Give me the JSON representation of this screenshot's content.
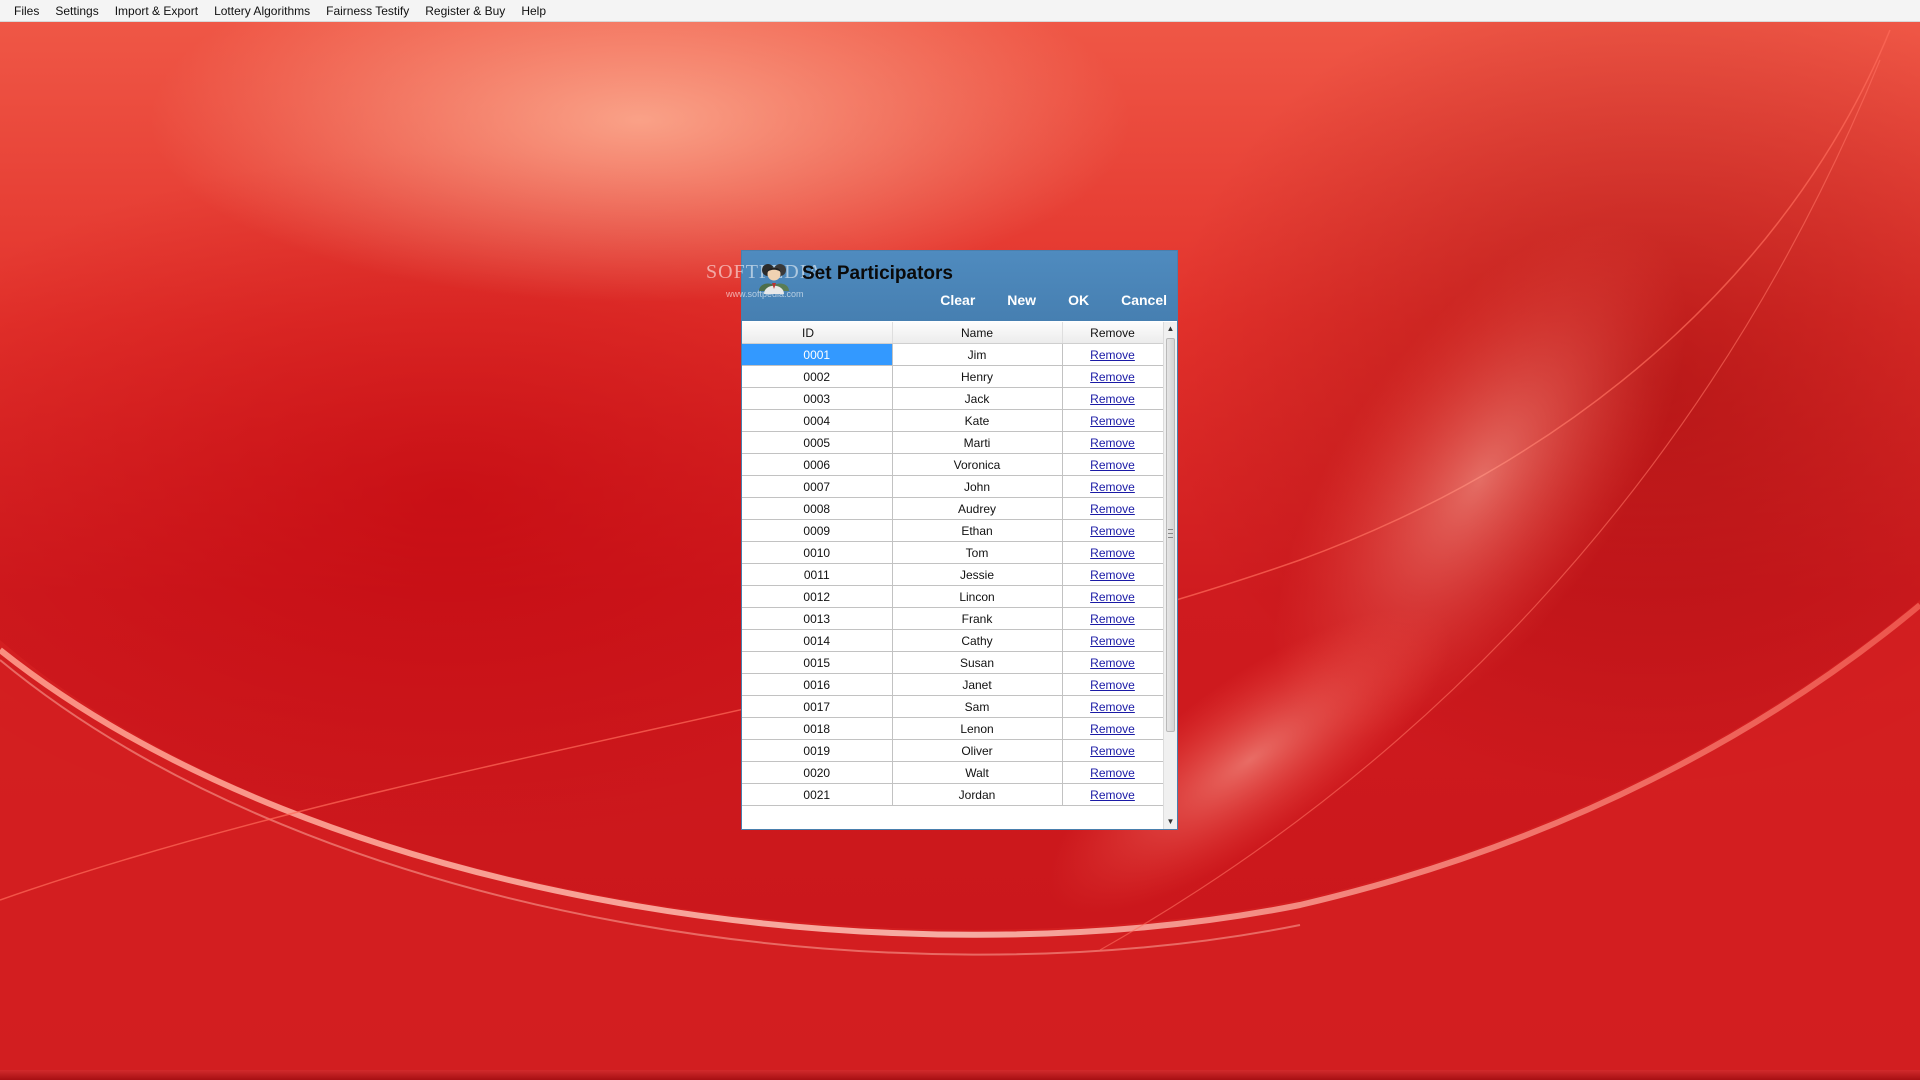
{
  "menubar": {
    "items": [
      {
        "label": "Files"
      },
      {
        "label": "Settings"
      },
      {
        "label": "Import & Export"
      },
      {
        "label": "Lottery Algorithms"
      },
      {
        "label": "Fairness Testify"
      },
      {
        "label": "Register & Buy"
      },
      {
        "label": "Help"
      }
    ]
  },
  "dialog": {
    "title": "Set Participators",
    "watermark": "SOFTPEDIA",
    "watermark_url": "www.softpedia.com",
    "icon": "participants-icon",
    "buttons": {
      "clear": "Clear",
      "new": "New",
      "ok": "OK",
      "cancel": "Cancel"
    },
    "table": {
      "columns": [
        "ID",
        "Name",
        "Remove"
      ],
      "selected_row": 0,
      "rows": [
        {
          "id": "0001",
          "name": "Jim",
          "action": "Remove"
        },
        {
          "id": "0002",
          "name": "Henry",
          "action": "Remove"
        },
        {
          "id": "0003",
          "name": "Jack",
          "action": "Remove"
        },
        {
          "id": "0004",
          "name": "Kate",
          "action": "Remove"
        },
        {
          "id": "0005",
          "name": "Marti",
          "action": "Remove"
        },
        {
          "id": "0006",
          "name": "Voronica",
          "action": "Remove"
        },
        {
          "id": "0007",
          "name": "John",
          "action": "Remove"
        },
        {
          "id": "0008",
          "name": "Audrey",
          "action": "Remove"
        },
        {
          "id": "0009",
          "name": "Ethan",
          "action": "Remove"
        },
        {
          "id": "0010",
          "name": "Tom",
          "action": "Remove"
        },
        {
          "id": "0011",
          "name": "Jessie",
          "action": "Remove"
        },
        {
          "id": "0012",
          "name": "Lincon",
          "action": "Remove"
        },
        {
          "id": "0013",
          "name": "Frank",
          "action": "Remove"
        },
        {
          "id": "0014",
          "name": "Cathy",
          "action": "Remove"
        },
        {
          "id": "0015",
          "name": "Susan",
          "action": "Remove"
        },
        {
          "id": "0016",
          "name": "Janet",
          "action": "Remove"
        },
        {
          "id": "0017",
          "name": "Sam",
          "action": "Remove"
        },
        {
          "id": "0018",
          "name": "Lenon",
          "action": "Remove"
        },
        {
          "id": "0019",
          "name": "Oliver",
          "action": "Remove"
        },
        {
          "id": "0020",
          "name": "Walt",
          "action": "Remove"
        },
        {
          "id": "0021",
          "name": "Jordan",
          "action": "Remove"
        }
      ]
    }
  },
  "colors": {
    "header_blue": "#4a84b8",
    "selection_blue": "#3399ff",
    "link_blue": "#1a1aa6",
    "background_red": "#c8161a"
  }
}
